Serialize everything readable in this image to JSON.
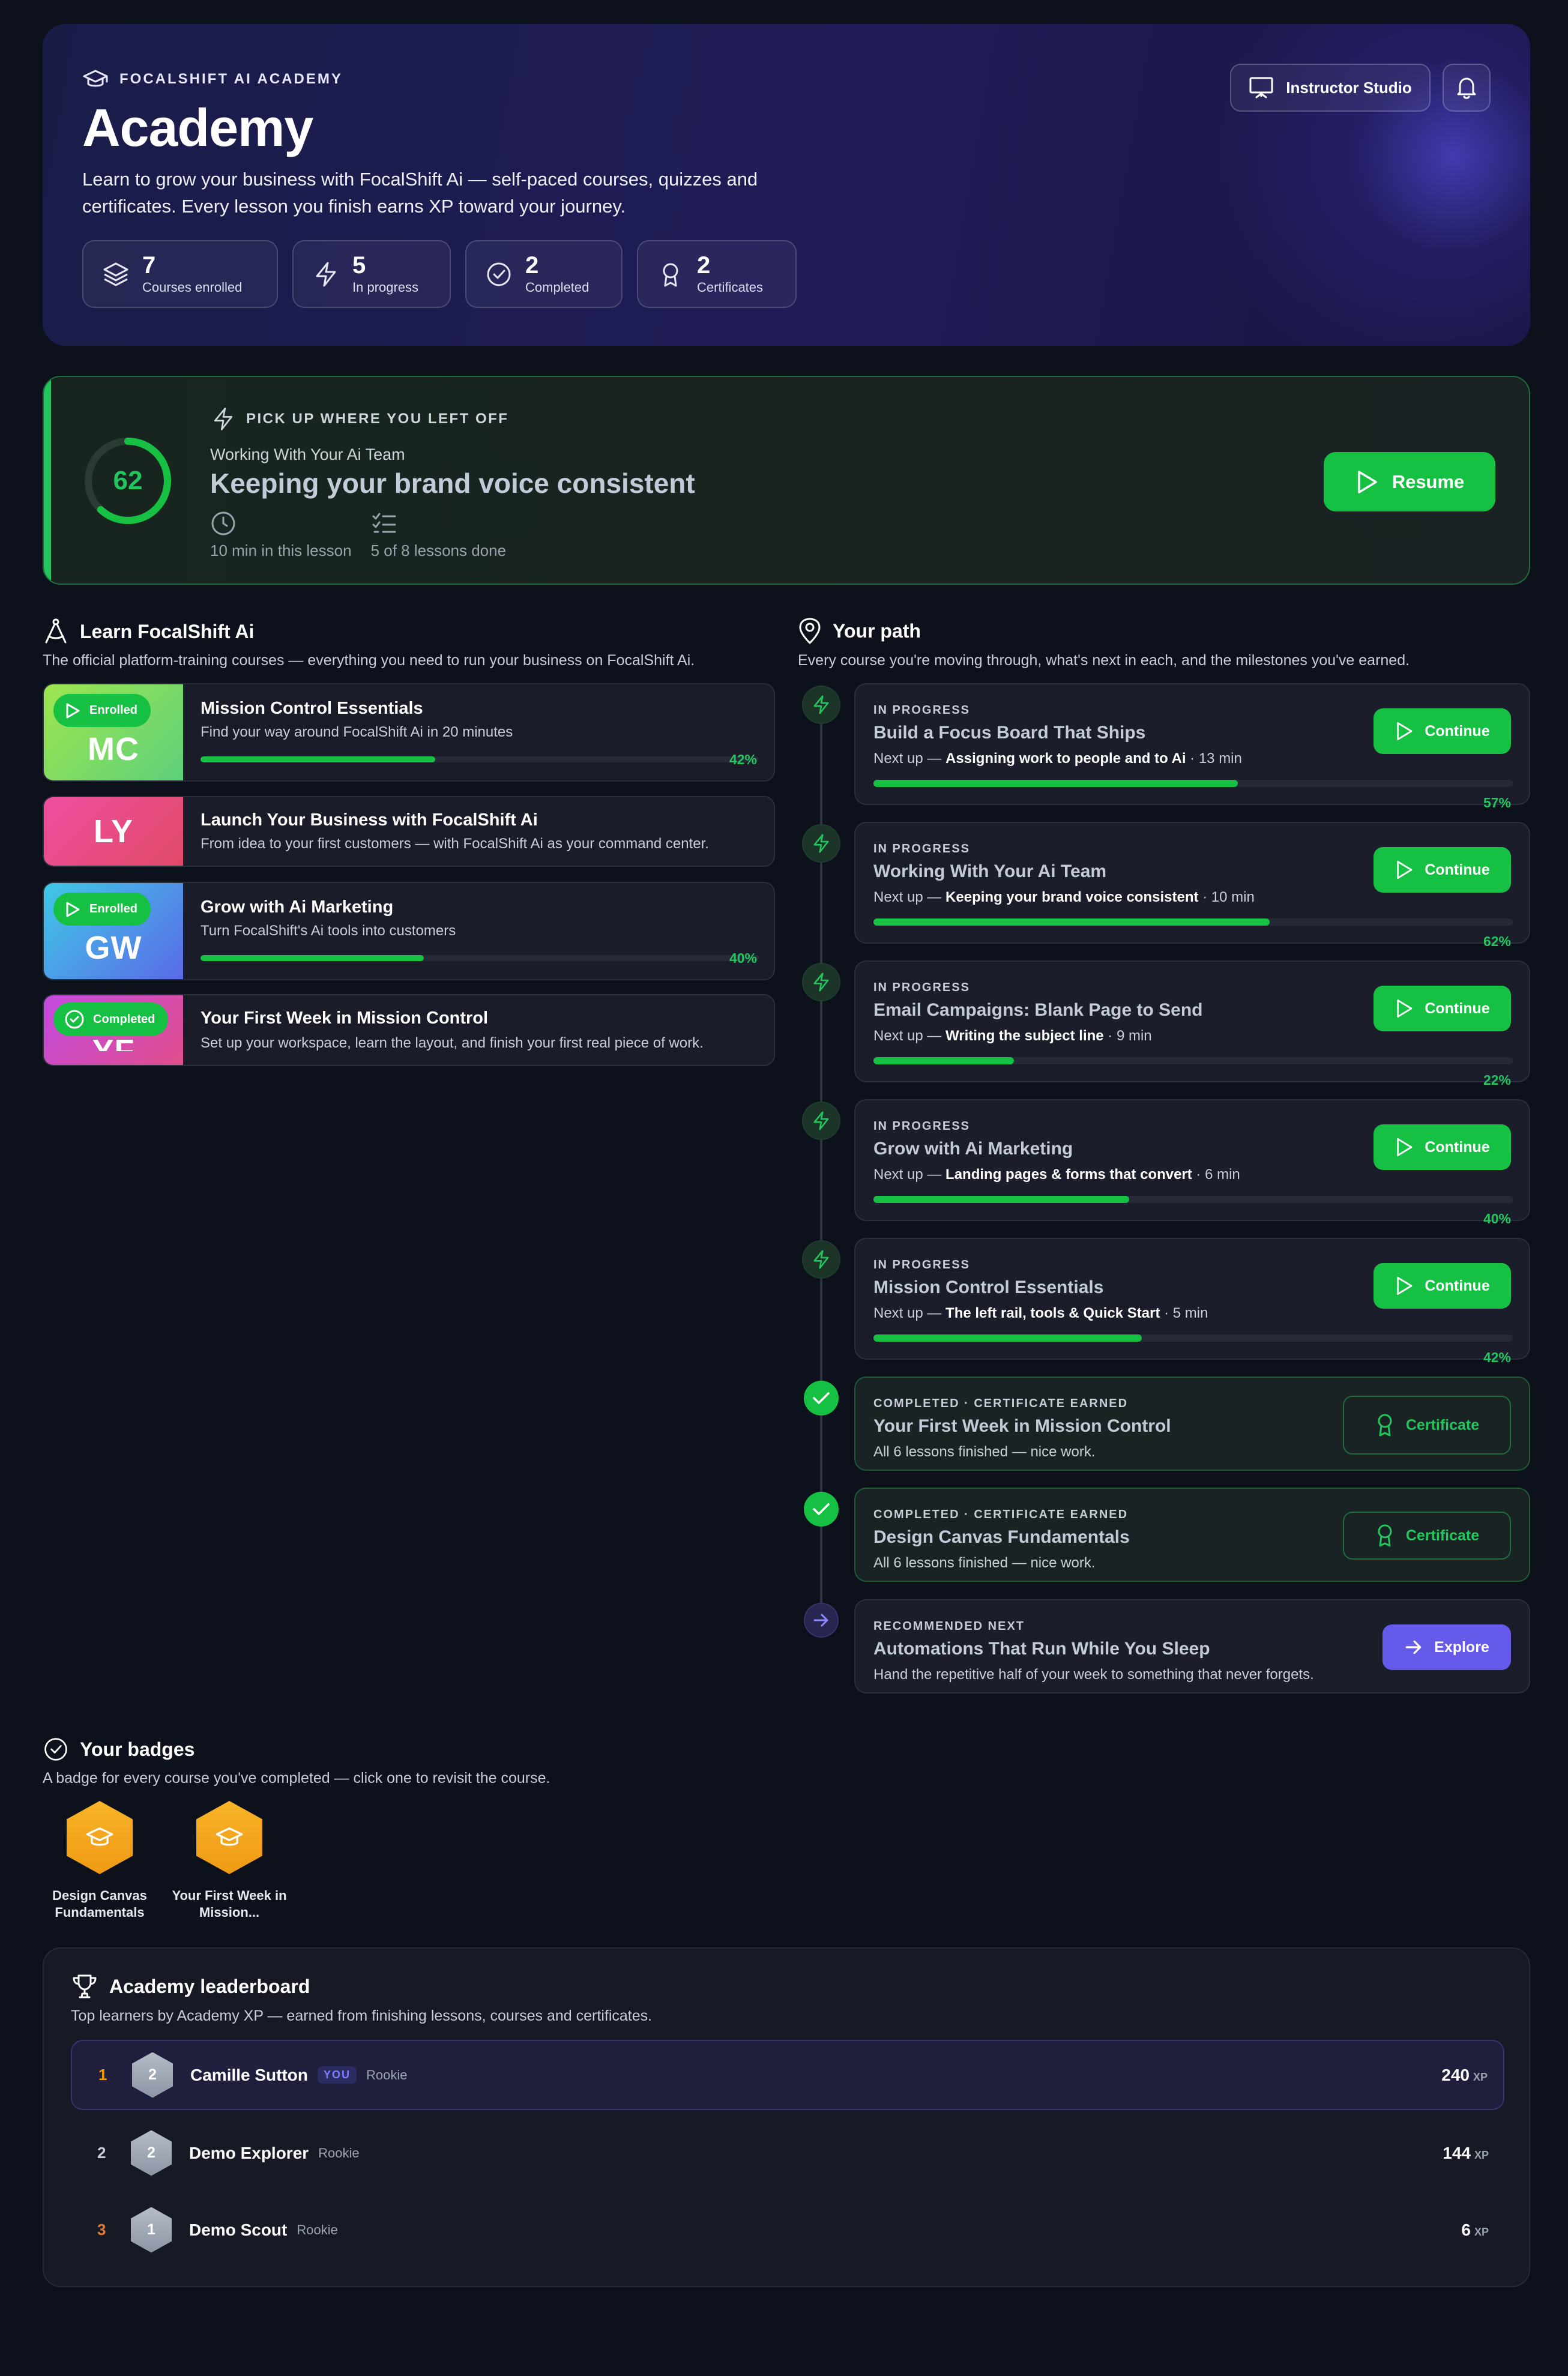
{
  "hero": {
    "brand": "FOCALSHIFT AI ACADEMY",
    "title": "Academy",
    "description": "Learn to grow your business with FocalShift Ai — self-paced courses, quizzes and certificates. Every lesson you finish earns XP toward your journey.",
    "instructor_button": "Instructor Studio",
    "stats": [
      {
        "value": "7",
        "label": "Courses enrolled",
        "icon": "layers-icon"
      },
      {
        "value": "5",
        "label": "In progress",
        "icon": "bolt-icon"
      },
      {
        "value": "2",
        "label": "Completed",
        "icon": "check-circle-icon"
      },
      {
        "value": "2",
        "label": "Certificates",
        "icon": "award-icon"
      }
    ]
  },
  "resume": {
    "kicker": "PICK UP WHERE YOU LEFT OFF",
    "progress": 62,
    "progress_label": "62",
    "course": "Working With Your Ai Team",
    "lesson": "Keeping your brand voice consistent",
    "time": "10 min in this lesson",
    "lessons_done": "5 of 8 lessons done",
    "button": "Resume"
  },
  "learn": {
    "title": "Learn FocalShift Ai",
    "subtitle": "The official platform-training courses — everything you need to run your business on FocalShift Ai.",
    "courses": [
      {
        "initials": "MC",
        "pill": "Enrolled",
        "title": "Mission Control Essentials",
        "desc": "Find your way around FocalShift Ai in 20 minutes",
        "progress": 42,
        "pct": "42%"
      },
      {
        "initials": "LY",
        "pill": "",
        "title": "Launch Your Business with FocalShift Ai",
        "desc": "From idea to your first customers — with FocalShift Ai as your command center.",
        "progress": null,
        "pct": ""
      },
      {
        "initials": "GW",
        "pill": "Enrolled",
        "title": "Grow with Ai Marketing",
        "desc": "Turn FocalShift's Ai tools into customers",
        "progress": 40,
        "pct": "40%"
      },
      {
        "initials": "YF",
        "pill": "Completed",
        "title": "Your First Week in Mission Control",
        "desc": "Set up your workspace, learn the layout, and finish your first real piece of work.",
        "progress": null,
        "pct": ""
      }
    ]
  },
  "path": {
    "title": "Your path",
    "subtitle": "Every course you're moving through, what's next in each, and the milestones you've earned.",
    "next_prefix": "Next up — ",
    "in_progress": [
      {
        "kicker": "IN PROGRESS",
        "title": "Build a Focus Board That Ships",
        "next": "Assigning work to people and to Ai",
        "time": " · 13 min",
        "progress": 57,
        "pct": "57%",
        "button": "Continue"
      },
      {
        "kicker": "IN PROGRESS",
        "title": "Working With Your Ai Team",
        "next": "Keeping your brand voice consistent",
        "time": " · 10 min",
        "progress": 62,
        "pct": "62%",
        "button": "Continue"
      },
      {
        "kicker": "IN PROGRESS",
        "title": "Email Campaigns: Blank Page to Send",
        "next": "Writing the subject line",
        "time": " · 9 min",
        "progress": 22,
        "pct": "22%",
        "button": "Continue"
      },
      {
        "kicker": "IN PROGRESS",
        "title": "Grow with Ai Marketing",
        "next": "Landing pages & forms that convert",
        "time": " · 6 min",
        "progress": 40,
        "pct": "40%",
        "button": "Continue"
      },
      {
        "kicker": "IN PROGRESS",
        "title": "Mission Control Essentials",
        "next": "The left rail, tools & Quick Start",
        "time": " · 5 min",
        "progress": 42,
        "pct": "42%",
        "button": "Continue"
      }
    ],
    "completed": [
      {
        "kicker": "COMPLETED · CERTIFICATE EARNED",
        "title": "Your First Week in Mission Control",
        "desc": "All 6 lessons finished — nice work.",
        "button": "Certificate"
      },
      {
        "kicker": "COMPLETED · CERTIFICATE EARNED",
        "title": "Design Canvas Fundamentals",
        "desc": "All 6 lessons finished — nice work.",
        "button": "Certificate"
      }
    ],
    "recommended": {
      "kicker": "RECOMMENDED NEXT",
      "title": "Automations That Run While You Sleep",
      "desc": "Hand the repetitive half of your week to something that never forgets.",
      "button": "Explore"
    }
  },
  "badges": {
    "title": "Your badges",
    "subtitle": "A badge for every course you've completed — click one to revisit the course.",
    "items": [
      {
        "label": "Design Canvas Fundamentals"
      },
      {
        "label": "Your First Week in Mission..."
      }
    ]
  },
  "leaderboard": {
    "title": "Academy leaderboard",
    "subtitle": "Top learners by Academy XP — earned from finishing lessons, courses and certificates.",
    "xp_unit": "XP",
    "you_tag": "YOU",
    "rows": [
      {
        "rank": "1",
        "level": "2",
        "name": "Camille Sutton",
        "tier": "Rookie",
        "xp": "240",
        "me": true
      },
      {
        "rank": "2",
        "level": "2",
        "name": "Demo Explorer",
        "tier": "Rookie",
        "xp": "144",
        "me": false
      },
      {
        "rank": "3",
        "level": "1",
        "name": "Demo Scout",
        "tier": "Rookie",
        "xp": "6",
        "me": false
      }
    ]
  },
  "colors": {
    "accent_green": "#16c043",
    "accent_purple": "#6559ea",
    "badge_gold": "#f5a81e",
    "rank_gold": "#f59e0b",
    "rank_bronze": "#e07b39"
  }
}
